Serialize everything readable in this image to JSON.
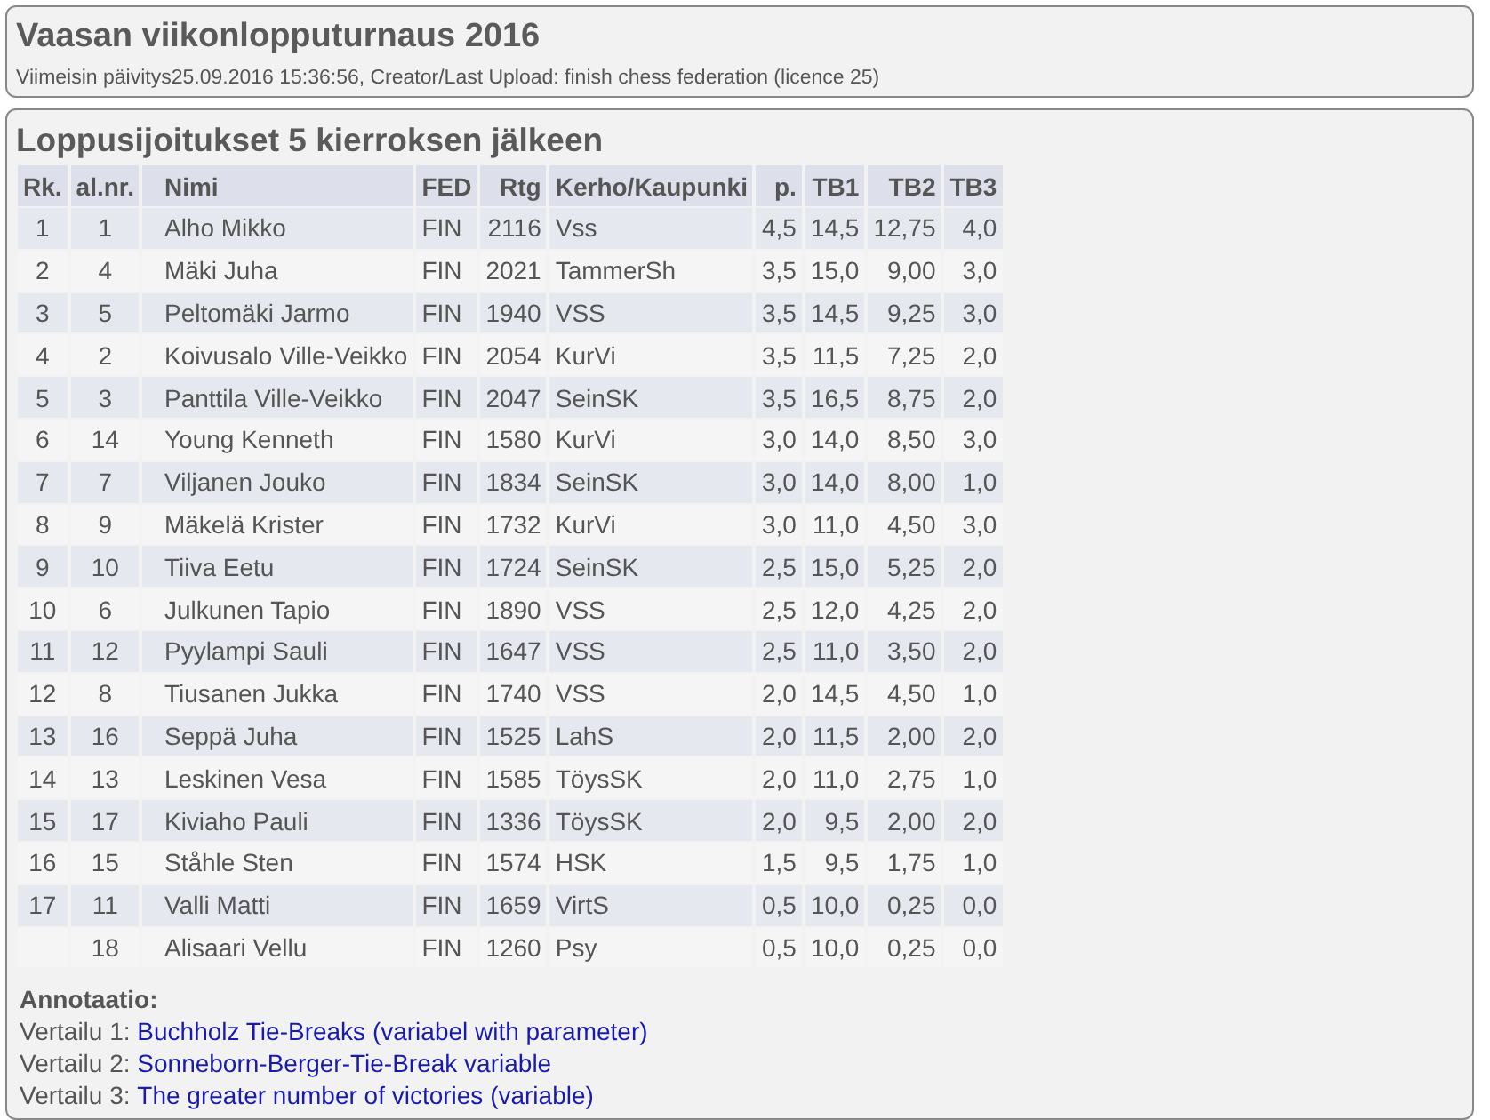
{
  "header": {
    "title": "Vaasan viikonlopputurnaus 2016",
    "subtitle": "Viimeisin päivitys25.09.2016 15:36:56, Creator/Last Upload: finish chess federation (licence 25)"
  },
  "standings": {
    "title": "Loppusijoitukset 5 kierroksen jälkeen",
    "columns": [
      "Rk.",
      "al.nr.",
      "Nimi",
      "FED",
      "Rtg",
      "Kerho/Kaupunki",
      "p.",
      "TB1",
      "TB2",
      "TB3"
    ],
    "rows": [
      {
        "rank": "1",
        "start_no": "1",
        "name": "Alho Mikko",
        "fed": "FIN",
        "rating": "2116",
        "club": "Vss",
        "points": "4,5",
        "tb1": "14,5",
        "tb2": "12,75",
        "tb3": "4,0"
      },
      {
        "rank": "2",
        "start_no": "4",
        "name": "Mäki Juha",
        "fed": "FIN",
        "rating": "2021",
        "club": "TammerSh",
        "points": "3,5",
        "tb1": "15,0",
        "tb2": "9,00",
        "tb3": "3,0"
      },
      {
        "rank": "3",
        "start_no": "5",
        "name": "Peltomäki Jarmo",
        "fed": "FIN",
        "rating": "1940",
        "club": "VSS",
        "points": "3,5",
        "tb1": "14,5",
        "tb2": "9,25",
        "tb3": "3,0"
      },
      {
        "rank": "4",
        "start_no": "2",
        "name": "Koivusalo Ville-Veikko",
        "fed": "FIN",
        "rating": "2054",
        "club": "KurVi",
        "points": "3,5",
        "tb1": "11,5",
        "tb2": "7,25",
        "tb3": "2,0"
      },
      {
        "rank": "5",
        "start_no": "3",
        "name": "Panttila Ville-Veikko",
        "fed": "FIN",
        "rating": "2047",
        "club": "SeinSK",
        "points": "3,5",
        "tb1": "16,5",
        "tb2": "8,75",
        "tb3": "2,0"
      },
      {
        "rank": "6",
        "start_no": "14",
        "name": "Young Kenneth",
        "fed": "FIN",
        "rating": "1580",
        "club": "KurVi",
        "points": "3,0",
        "tb1": "14,0",
        "tb2": "8,50",
        "tb3": "3,0"
      },
      {
        "rank": "7",
        "start_no": "7",
        "name": "Viljanen Jouko",
        "fed": "FIN",
        "rating": "1834",
        "club": "SeinSK",
        "points": "3,0",
        "tb1": "14,0",
        "tb2": "8,00",
        "tb3": "1,0"
      },
      {
        "rank": "8",
        "start_no": "9",
        "name": "Mäkelä Krister",
        "fed": "FIN",
        "rating": "1732",
        "club": "KurVi",
        "points": "3,0",
        "tb1": "11,0",
        "tb2": "4,50",
        "tb3": "3,0"
      },
      {
        "rank": "9",
        "start_no": "10",
        "name": "Tiiva Eetu",
        "fed": "FIN",
        "rating": "1724",
        "club": "SeinSK",
        "points": "2,5",
        "tb1": "15,0",
        "tb2": "5,25",
        "tb3": "2,0"
      },
      {
        "rank": "10",
        "start_no": "6",
        "name": "Julkunen Tapio",
        "fed": "FIN",
        "rating": "1890",
        "club": "VSS",
        "points": "2,5",
        "tb1": "12,0",
        "tb2": "4,25",
        "tb3": "2,0"
      },
      {
        "rank": "11",
        "start_no": "12",
        "name": "Pyylampi Sauli",
        "fed": "FIN",
        "rating": "1647",
        "club": "VSS",
        "points": "2,5",
        "tb1": "11,0",
        "tb2": "3,50",
        "tb3": "2,0"
      },
      {
        "rank": "12",
        "start_no": "8",
        "name": "Tiusanen Jukka",
        "fed": "FIN",
        "rating": "1740",
        "club": "VSS",
        "points": "2,0",
        "tb1": "14,5",
        "tb2": "4,50",
        "tb3": "1,0"
      },
      {
        "rank": "13",
        "start_no": "16",
        "name": "Seppä Juha",
        "fed": "FIN",
        "rating": "1525",
        "club": "LahS",
        "points": "2,0",
        "tb1": "11,5",
        "tb2": "2,00",
        "tb3": "2,0"
      },
      {
        "rank": "14",
        "start_no": "13",
        "name": "Leskinen Vesa",
        "fed": "FIN",
        "rating": "1585",
        "club": "TöysSK",
        "points": "2,0",
        "tb1": "11,0",
        "tb2": "2,75",
        "tb3": "1,0"
      },
      {
        "rank": "15",
        "start_no": "17",
        "name": "Kiviaho Pauli",
        "fed": "FIN",
        "rating": "1336",
        "club": "TöysSK",
        "points": "2,0",
        "tb1": "9,5",
        "tb2": "2,00",
        "tb3": "2,0"
      },
      {
        "rank": "16",
        "start_no": "15",
        "name": "Ståhle Sten",
        "fed": "FIN",
        "rating": "1574",
        "club": "HSK",
        "points": "1,5",
        "tb1": "9,5",
        "tb2": "1,75",
        "tb3": "1,0"
      },
      {
        "rank": "17",
        "start_no": "11",
        "name": "Valli Matti",
        "fed": "FIN",
        "rating": "1659",
        "club": "VirtS",
        "points": "0,5",
        "tb1": "10,0",
        "tb2": "0,25",
        "tb3": "0,0"
      },
      {
        "start_no": "18",
        "name": "Alisaari Vellu",
        "fed": "FIN",
        "rating": "1260",
        "club": "Psy",
        "points": "0,5",
        "tb1": "10,0",
        "tb2": "0,25",
        "tb3": "0,0"
      }
    ],
    "annotation": {
      "title": "Annotaatio:",
      "items": [
        {
          "label": "Vertailu 1:",
          "link": "Buchholz Tie-Breaks (variabel with parameter)"
        },
        {
          "label": "Vertailu 2:",
          "link": "Sonneborn-Berger-Tie-Break variable"
        },
        {
          "label": "Vertailu 3:",
          "link": "The greater number of victories (variable)"
        }
      ]
    }
  }
}
